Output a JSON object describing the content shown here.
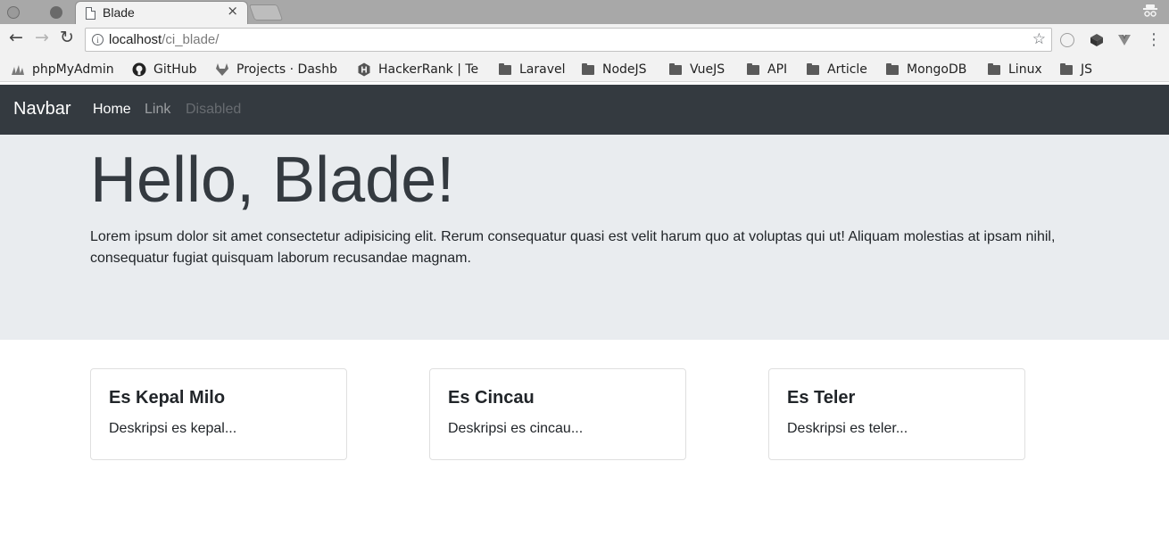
{
  "browser": {
    "tab": {
      "title": "Blade",
      "close_glyph": "×",
      "icon": "page-icon"
    },
    "address": {
      "host": "localhost",
      "path": "/ci_blade/"
    },
    "glyphs": {
      "back": "←",
      "forward": "→",
      "reload": "↻",
      "star": "☆",
      "menu": "⋮",
      "info": "i"
    },
    "bookmarks": [
      {
        "label": "phpMyAdmin",
        "icon": "phpmyadmin-icon"
      },
      {
        "label": "GitHub",
        "icon": "github-icon"
      },
      {
        "label": "Projects · Dashb",
        "icon": "gitlab-icon"
      },
      {
        "label": "HackerRank | Te",
        "icon": "hackerrank-icon"
      },
      {
        "label": "Laravel",
        "icon": "folder-icon"
      },
      {
        "label": "NodeJS",
        "icon": "folder-icon"
      },
      {
        "label": "VueJS",
        "icon": "folder-icon"
      },
      {
        "label": "API",
        "icon": "folder-icon"
      },
      {
        "label": "Article",
        "icon": "folder-icon"
      },
      {
        "label": "MongoDB",
        "icon": "folder-icon"
      },
      {
        "label": "Linux",
        "icon": "folder-icon"
      },
      {
        "label": "JS",
        "icon": "folder-icon"
      }
    ]
  },
  "navbar": {
    "brand": "Navbar",
    "links": [
      {
        "label": "Home",
        "state": "active"
      },
      {
        "label": "Link",
        "state": "normal"
      },
      {
        "label": "Disabled",
        "state": "disabled"
      }
    ],
    "bg_color": "#343a40"
  },
  "jumbotron": {
    "heading": "Hello, Blade!",
    "lead": "Lorem ipsum dolor sit amet consectetur adipisicing elit. Rerum consequatur quasi est velit harum quo at voluptas qui ut! Aliquam molestias at ipsam nihil, consequatur fugiat quisquam laborum recusandae magnam.",
    "bg_color": "#e9ecef"
  },
  "cards": [
    {
      "title": "Es Kepal Milo",
      "text": "Deskripsi es kepal..."
    },
    {
      "title": "Es Cincau",
      "text": "Deskripsi es cincau..."
    },
    {
      "title": "Es Teler",
      "text": "Deskripsi es teler..."
    }
  ]
}
